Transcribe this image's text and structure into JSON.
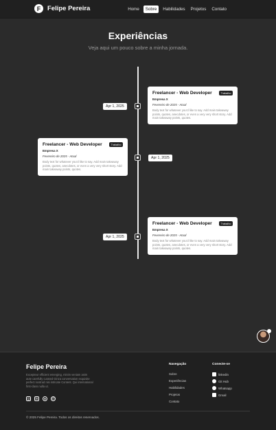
{
  "header": {
    "logo_letter": "F",
    "brand": "Felipe Pereira",
    "nav": [
      {
        "label": "Home"
      },
      {
        "label": "Sobre"
      },
      {
        "label": "Habilidades"
      },
      {
        "label": "Projetos"
      },
      {
        "label": "Contato"
      }
    ],
    "active_nav": "Sobre"
  },
  "hero": {
    "title": "Experiências",
    "subtitle": "Veja aqui um pouco sobre a minha jornada."
  },
  "timeline": [
    {
      "date": "Apr 1, 2025",
      "title": "Freelancer - Web Developer",
      "badge": "Trabalho",
      "company": "Empresa X",
      "period": "Fevereiro de 2025 - Atual",
      "description": "Body text for whatever you'd like to say. Add main takeaway points, quotes, anecdotes, or even a very very short story. Add main takeaway points, quotes."
    },
    {
      "date": "Apr 1, 2025",
      "title": "Freelancer - Web Developer",
      "badge": "Trabalho",
      "company": "Empresa X",
      "period": "Fevereiro de 2025 - Atual",
      "description": "Body text for whatever you'd like to say. Add main takeaway points, quotes, anecdotes, or even a very very short story. Add main takeaway points, quotes."
    },
    {
      "date": "Apr 1, 2025",
      "title": "Freelancer - Web Developer",
      "badge": "Trabalho",
      "company": "Empresa X",
      "period": "Fevereiro de 2025 - Atual",
      "description": "Body text for whatever you'd like to say. Add main takeaway points, quotes, anecdotes, or even a very very short story. Add main takeaway points, quotes."
    }
  ],
  "footer": {
    "brand": "Felipe Pereira",
    "description": "Excepteur efficient emerging, minim veniam anim aute carefully curated Ginza conversation exquisite perfect nostrud nisi intricate Content. Qui international first-class nulla ut.",
    "social_icons": [
      "instagram-icon",
      "linkedin-icon",
      "github-icon",
      "whatsapp-icon"
    ],
    "nav_title": "Navegação",
    "nav_links": [
      "Sobre",
      "Experiências",
      "Habilidades",
      "Projetos",
      "Contato"
    ],
    "connect_title": "Conecte-se",
    "connect_links": [
      {
        "label": "linkedin",
        "icon": "linkedin-icon"
      },
      {
        "label": "Git Hub",
        "icon": "github-icon"
      },
      {
        "label": "Whatsapp",
        "icon": "whatsapp-icon"
      },
      {
        "label": "Gmail",
        "icon": "mail-icon"
      }
    ],
    "copyright": "© 2025 Felipe Pereira. Todos os direitos reservados."
  },
  "colors": {
    "background": "#2b2b2b",
    "header": "#202020",
    "card": "#ffffff",
    "accent": "#ffffff"
  }
}
